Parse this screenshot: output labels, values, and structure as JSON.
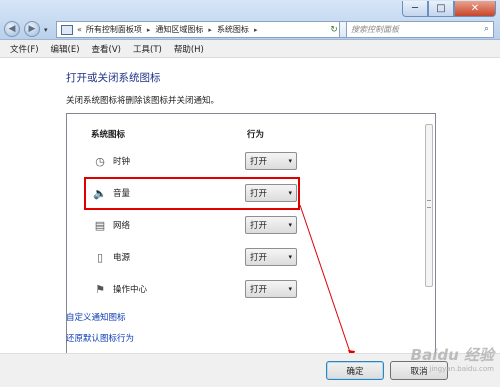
{
  "window": {
    "minimize": "─",
    "maximize": "□",
    "close": "✕"
  },
  "nav": {
    "back": "◀",
    "forward": "▶",
    "dropdown": "▾"
  },
  "address": {
    "chevron": "«",
    "crumbs": [
      "所有控制面板项",
      "通知区域图标",
      "系统图标"
    ],
    "separator": "▸",
    "dropdown": "▾",
    "refresh": "↻"
  },
  "search": {
    "placeholder": "搜索控制面板",
    "icon": "search-icon"
  },
  "menu": [
    "文件(F)",
    "编辑(E)",
    "查看(V)",
    "工具(T)",
    "帮助(H)"
  ],
  "page": {
    "title": "打开或关闭系统图标",
    "description": "关闭系统图标将删除该图标并关闭通知。"
  },
  "table": {
    "headers": {
      "icon_col": "系统图标",
      "behavior_col": "行为"
    },
    "rows": [
      {
        "label": "时钟",
        "icon": "clock-icon",
        "glyph": "◷",
        "value": "打开"
      },
      {
        "label": "音量",
        "icon": "speaker-icon",
        "glyph": "🔈",
        "value": "打开"
      },
      {
        "label": "网络",
        "icon": "network-icon",
        "glyph": "▤",
        "value": "打开"
      },
      {
        "label": "电源",
        "icon": "power-icon",
        "glyph": "▯",
        "value": "打开"
      },
      {
        "label": "操作中心",
        "icon": "flag-icon",
        "glyph": "⚑",
        "value": "打开"
      }
    ],
    "arrow": "▾"
  },
  "links": {
    "customize": "自定义通知图标",
    "restore": "还原默认图标行为"
  },
  "buttons": {
    "ok": "确定",
    "cancel": "取消"
  },
  "watermark": {
    "text": "Baidu 经验",
    "sub": "jingyan.baidu.com"
  },
  "colors": {
    "highlight": "#e00000",
    "link": "#0d3cb5",
    "title": "#1e3287"
  }
}
